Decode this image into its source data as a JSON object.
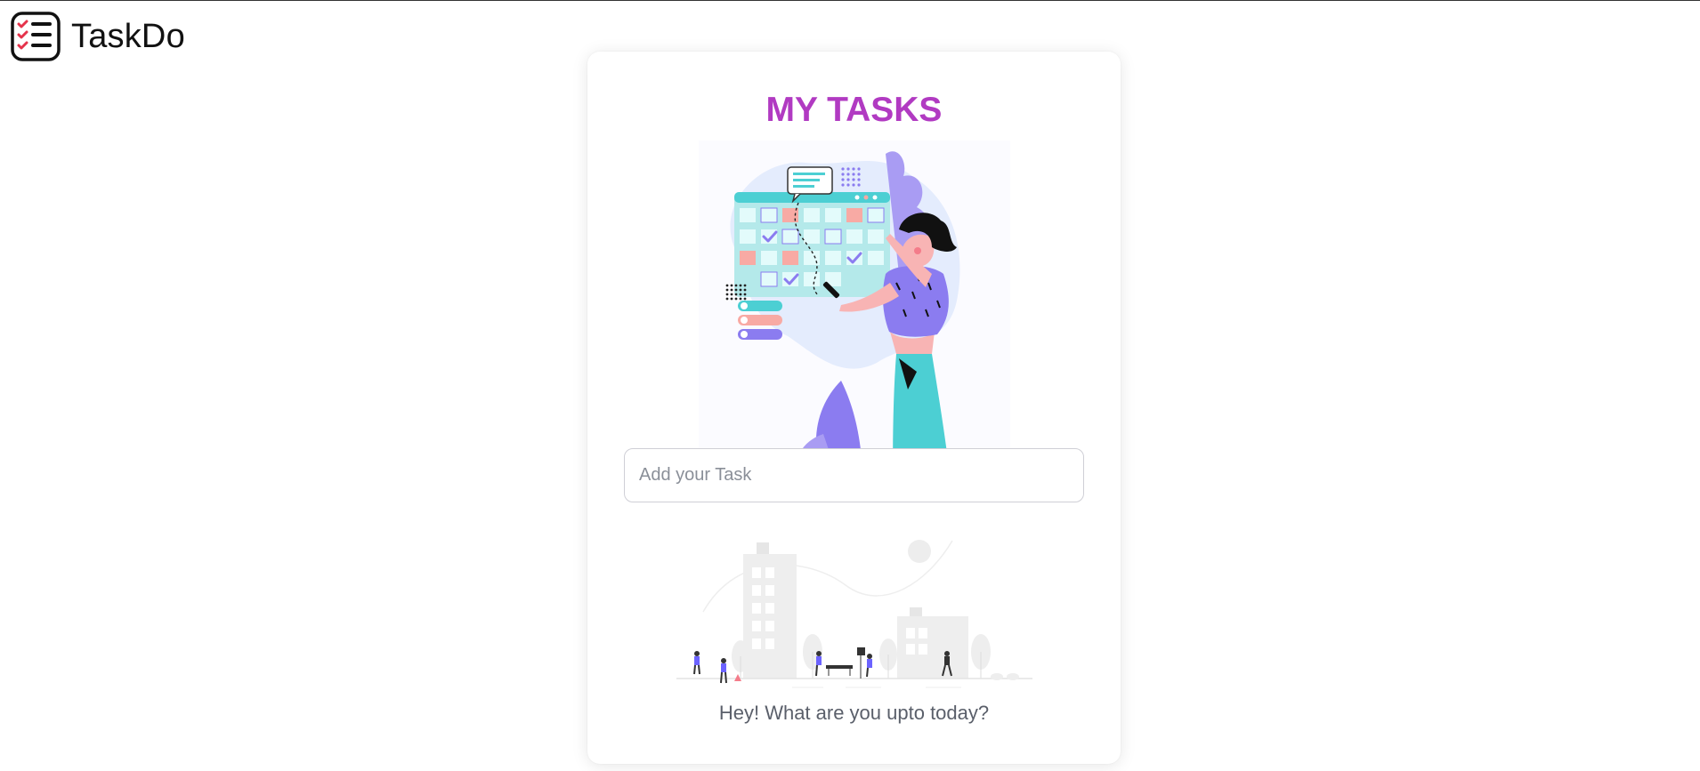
{
  "app": {
    "name": "TaskDo",
    "logo_icon": "checklist-icon"
  },
  "card": {
    "title": "MY TASKS",
    "hero_illustration": "woman-with-calendar-illustration",
    "input": {
      "placeholder": "Add your Task",
      "value": ""
    },
    "empty_state": {
      "illustration": "city-park-illustration",
      "message": "Hey! What are you upto today?"
    }
  },
  "colors": {
    "title": "#b13ac2",
    "accent_teal": "#4ccfd3",
    "accent_purple": "#8b7cf0",
    "accent_pink": "#f8aaa4"
  }
}
